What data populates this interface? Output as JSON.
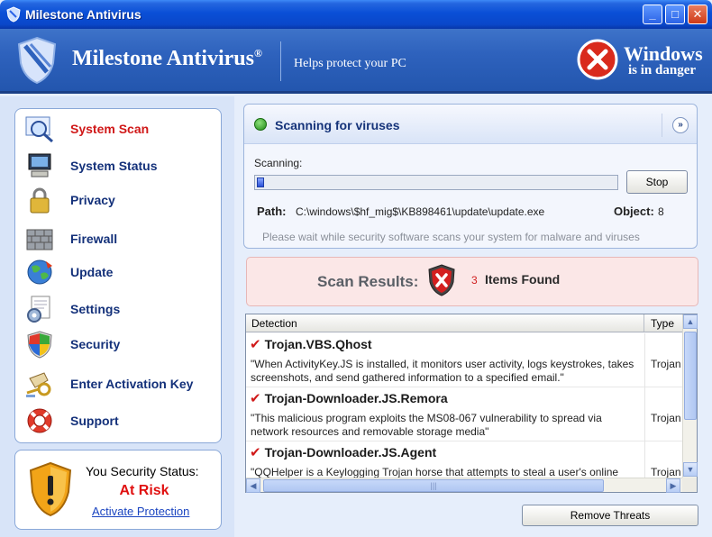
{
  "window": {
    "title": "Milestone Antivirus"
  },
  "header": {
    "brand": "Milestone Antivirus",
    "registered": "®",
    "tagline": "Helps protect your PC",
    "danger_line1": "Windows",
    "danger_line2": "is in danger"
  },
  "sidebar": {
    "items": [
      {
        "label": "System Scan",
        "icon": "magnifier-scan-icon",
        "active": true
      },
      {
        "label": "System Status",
        "icon": "computer-icon"
      },
      {
        "label": "Privacy",
        "icon": "padlock-icon"
      },
      {
        "label": "Firewall",
        "icon": "brick-wall-icon"
      },
      {
        "label": "Update",
        "icon": "globe-icon"
      },
      {
        "label": "Settings",
        "icon": "gear-document-icon"
      },
      {
        "label": "Security",
        "icon": "windows-shield-icon"
      },
      {
        "label": "Enter Activation Key",
        "icon": "key-hand-icon"
      },
      {
        "label": "Support",
        "icon": "lifebuoy-icon"
      }
    ]
  },
  "security_status": {
    "title": "You Security Status:",
    "status": "At Risk",
    "link": "Activate Protection"
  },
  "scan": {
    "title": "Scanning for viruses",
    "collapse_glyph": "»",
    "scanning_label": "Scanning:",
    "progress": 0.02,
    "stop_label": "Stop",
    "path_label": "Path:",
    "path_value": "C:\\windows\\$hf_mig$\\KB898461\\update\\update.exe",
    "object_label": "Object:",
    "object_value": "8",
    "wait_message": "Please wait while security software scans your system for malware and viruses"
  },
  "results": {
    "label": "Scan Results:",
    "count": "3",
    "items_text": "Items Found"
  },
  "threats": {
    "columns": [
      "Detection",
      "Type"
    ],
    "rows": [
      {
        "name": "Trojan.VBS.Qhost",
        "description": "\"When ActivityKey.JS is installed, it monitors user activity, logs keystrokes, takes screenshots, and send gathered information to a specified email.\"",
        "type": "Trojan"
      },
      {
        "name": "Trojan-Downloader.JS.Remora",
        "description": "\"This malicious program exploits the MS08-067 vulnerability to spread via network resources and removable storage media\"",
        "type": "Trojan"
      },
      {
        "name": "Trojan-Downloader.JS.Agent",
        "description": "\"QQHelper is a Keylogging Trojan horse that attempts to steal a user's online",
        "type": "Trojan"
      }
    ]
  },
  "actions": {
    "remove_label": "Remove Threats"
  },
  "colors": {
    "title_blue": "#0a4fd6",
    "banner_blue": "#2e62bd",
    "risk_red": "#e01010",
    "nav_blue": "#14317a"
  }
}
